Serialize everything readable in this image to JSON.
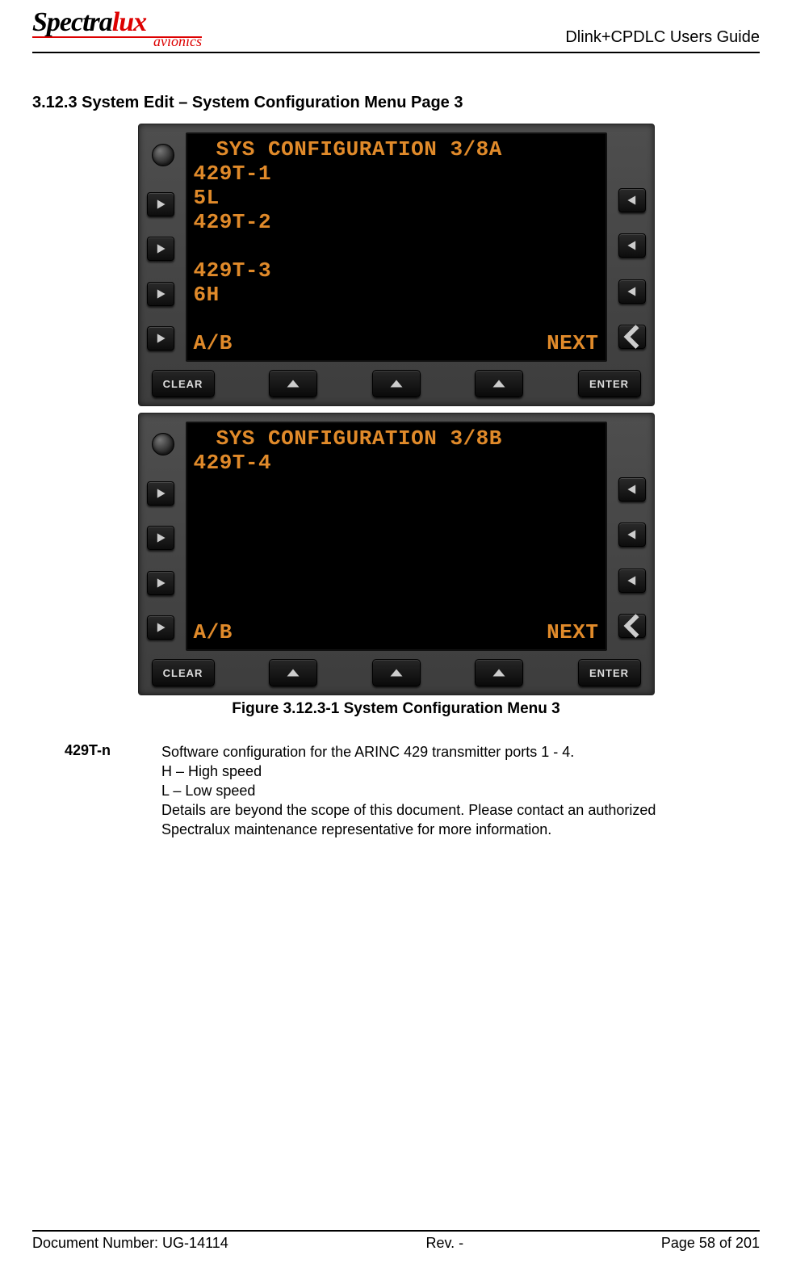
{
  "header": {
    "logo_main_black": "Spectra",
    "logo_main_accent": "lux",
    "logo_sub": "avionics",
    "doc_title": "Dlink+CPDLC Users Guide"
  },
  "section_heading": "3.12.3 System Edit – System Configuration Menu Page 3",
  "screens": {
    "a": {
      "title": " SYS CONFIGURATION 3/8A",
      "lines": [
        "429T-1",
        "5L",
        "429T-2",
        "",
        "429T-3",
        "6H",
        ""
      ],
      "bottom_left": "A/B",
      "bottom_right": "NEXT"
    },
    "b": {
      "title": " SYS CONFIGURATION 3/8B",
      "lines": [
        "429T-4",
        "",
        "",
        "",
        "",
        "",
        ""
      ],
      "bottom_left": "A/B",
      "bottom_right": "NEXT"
    }
  },
  "bezel": {
    "clear": "CLEAR",
    "enter": "ENTER"
  },
  "figure_caption": "Figure 3.12.3-1 System Configuration Menu 3",
  "definition": {
    "term": "429T-n",
    "line1": "Software configuration for the ARINC 429 transmitter ports 1 - 4.",
    "line2": "H – High speed",
    "line3": "L – Low speed",
    "line4": "Details are beyond the scope of this document.  Please contact an authorized Spectralux maintenance representative for more information."
  },
  "footer": {
    "doc_number": "Document Number:  UG-14114",
    "rev": "Rev. -",
    "page": "Page 58 of 201"
  }
}
